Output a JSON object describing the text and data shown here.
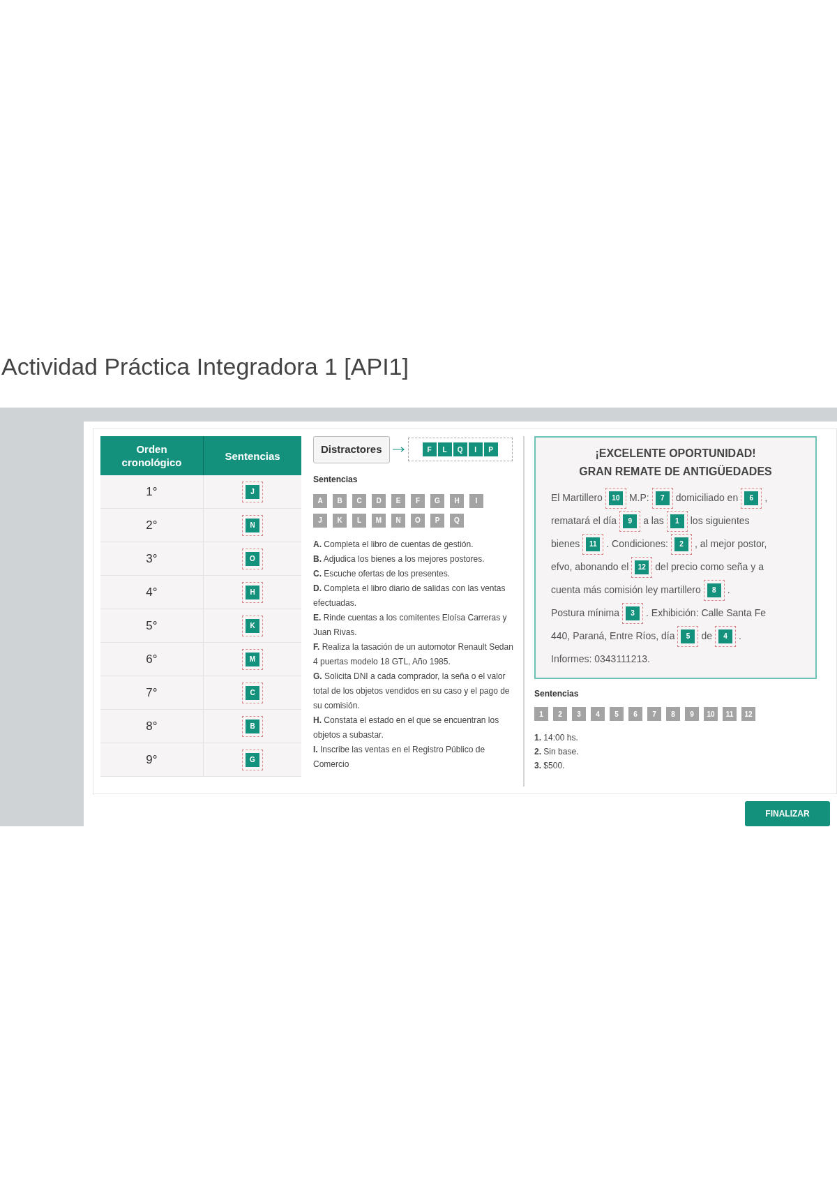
{
  "title": "Actividad Práctica Integradora 1 [API1]",
  "order_table": {
    "columns": [
      "Orden cronológico",
      "Sentencias"
    ],
    "rows": [
      {
        "ordinal": "1°",
        "answer": "J"
      },
      {
        "ordinal": "2°",
        "answer": "N"
      },
      {
        "ordinal": "3°",
        "answer": "O"
      },
      {
        "ordinal": "4°",
        "answer": "H"
      },
      {
        "ordinal": "5°",
        "answer": "K"
      },
      {
        "ordinal": "6°",
        "answer": "M"
      },
      {
        "ordinal": "7°",
        "answer": "C"
      },
      {
        "ordinal": "8°",
        "answer": "B"
      },
      {
        "ordinal": "9°",
        "answer": "G"
      }
    ]
  },
  "distractors": {
    "label": "Distractores",
    "chips": [
      "F",
      "L",
      "Q",
      "I",
      "P"
    ]
  },
  "sentences_panel": {
    "heading": "Sentencias",
    "chip_rows": [
      [
        "A",
        "B",
        "C",
        "D",
        "E",
        "F",
        "G",
        "H",
        "I"
      ],
      [
        "J",
        "K",
        "L",
        "M",
        "N",
        "O",
        "P",
        "Q"
      ]
    ],
    "statements": [
      {
        "letter": "A.",
        "text": "Completa el libro de cuentas de gestión."
      },
      {
        "letter": "B.",
        "text": "Adjudica los bienes a los mejores postores."
      },
      {
        "letter": "C.",
        "text": "Escuche ofertas de los presentes."
      },
      {
        "letter": "D.",
        "text": "Completa el libro diario de salidas con las ventas efectuadas."
      },
      {
        "letter": "E.",
        "text": "Rinde cuentas a los comitentes Eloísa Carreras y Juan Rivas."
      },
      {
        "letter": "F.",
        "text": "Realiza la tasación de un automotor Renault Sedan 4 puertas modelo 18 GTL, Año 1985."
      },
      {
        "letter": "G.",
        "text": "Solicita DNI a cada comprador, la seña o el valor total de los objetos vendidos en su caso y el pago de su comisión."
      },
      {
        "letter": "H.",
        "text": "Constata el estado en el que se encuentran los objetos a subastar."
      },
      {
        "letter": "I.",
        "text": "Inscribe las ventas en el Registro Público de Comercio"
      }
    ]
  },
  "notice": {
    "title_lines": [
      "¡EXCELENTE OPORTUNIDAD!",
      "GRAN REMATE DE ANTIGÜEDADES"
    ],
    "lines": [
      [
        {
          "kind": "text",
          "text": "El Martillero"
        },
        {
          "kind": "slot",
          "value": "10"
        },
        {
          "kind": "text",
          "text": "M.P:"
        },
        {
          "kind": "slot",
          "value": "7"
        },
        {
          "kind": "text",
          "text": "domiciliado en"
        },
        {
          "kind": "slot",
          "value": "6"
        },
        {
          "kind": "text",
          "text": ","
        }
      ],
      [
        {
          "kind": "text",
          "text": "rematará el día"
        },
        {
          "kind": "slot",
          "value": "9"
        },
        {
          "kind": "text",
          "text": "a las"
        },
        {
          "kind": "slot",
          "value": "1"
        },
        {
          "kind": "text",
          "text": "los siguientes"
        }
      ],
      [
        {
          "kind": "text",
          "text": "bienes"
        },
        {
          "kind": "slot",
          "value": "11"
        },
        {
          "kind": "text",
          "text": ". Condiciones:"
        },
        {
          "kind": "slot",
          "value": "2"
        },
        {
          "kind": "text",
          "text": ", al mejor postor,"
        }
      ],
      [
        {
          "kind": "text",
          "text": "efvo, abonando el"
        },
        {
          "kind": "slot",
          "value": "12"
        },
        {
          "kind": "text",
          "text": "del precio como seña y a"
        }
      ],
      [
        {
          "kind": "text",
          "text": "cuenta más comisión ley martillero"
        },
        {
          "kind": "slot",
          "value": "8"
        },
        {
          "kind": "text",
          "text": "."
        }
      ],
      [
        {
          "kind": "text",
          "text": "Postura mínima"
        },
        {
          "kind": "slot",
          "value": "3"
        },
        {
          "kind": "text",
          "text": ". Exhibición: Calle Santa Fe"
        }
      ],
      [
        {
          "kind": "text",
          "text": "440, Paraná, Entre Ríos, día"
        },
        {
          "kind": "slot",
          "value": "5"
        },
        {
          "kind": "text",
          "text": "de"
        },
        {
          "kind": "slot",
          "value": "4"
        },
        {
          "kind": "text",
          "text": "."
        }
      ],
      [
        {
          "kind": "text",
          "text": "Informes: 0343111213."
        }
      ]
    ]
  },
  "numbers_panel": {
    "heading": "Sentencias",
    "chips": [
      "1",
      "2",
      "3",
      "4",
      "5",
      "6",
      "7",
      "8",
      "9",
      "10",
      "11",
      "12"
    ],
    "items": [
      {
        "num": "1.",
        "text": "14:00 hs."
      },
      {
        "num": "2.",
        "text": "Sin base."
      },
      {
        "num": "3.",
        "text": "$500."
      }
    ]
  },
  "finish_button": "FINALIZAR"
}
